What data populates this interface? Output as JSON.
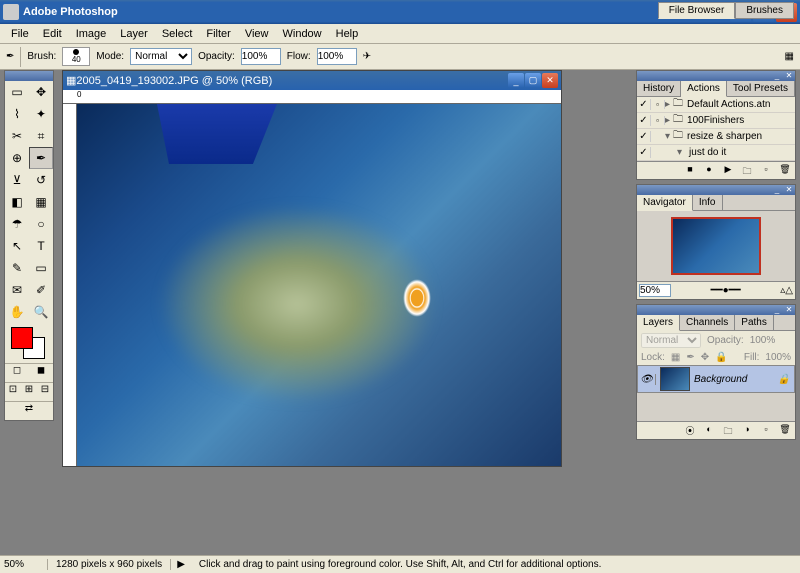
{
  "app": {
    "title": "Adobe Photoshop"
  },
  "menu": [
    "File",
    "Edit",
    "Image",
    "Layer",
    "Select",
    "Filter",
    "View",
    "Window",
    "Help"
  ],
  "options": {
    "brush_label": "Brush:",
    "brush_size": "40",
    "mode_label": "Mode:",
    "mode_value": "Normal",
    "opacity_label": "Opacity:",
    "opacity_value": "100%",
    "flow_label": "Flow:",
    "flow_value": "100%"
  },
  "palettewell": [
    "File Browser",
    "Brushes"
  ],
  "document": {
    "title": "2005_0419_193002.JPG @ 50% (RGB)",
    "ruler_mark": "0"
  },
  "actions_panel": {
    "tabs": [
      "History",
      "Actions",
      "Tool Presets"
    ],
    "items": [
      {
        "check": "✓",
        "dlg": "▫",
        "indent": 0,
        "tree": "▸",
        "folder": true,
        "label": "Default Actions.atn"
      },
      {
        "check": "✓",
        "dlg": "▫",
        "indent": 0,
        "tree": "▸",
        "folder": true,
        "label": "100Finishers"
      },
      {
        "check": "✓",
        "dlg": "",
        "indent": 0,
        "tree": "▾",
        "folder": true,
        "label": "resize & sharpen"
      },
      {
        "check": "✓",
        "dlg": "",
        "indent": 1,
        "tree": "▾",
        "folder": false,
        "label": "just do it"
      }
    ]
  },
  "navigator": {
    "tabs": [
      "Navigator",
      "Info"
    ],
    "zoom": "50%"
  },
  "layers": {
    "tabs": [
      "Layers",
      "Channels",
      "Paths"
    ],
    "blend": "Normal",
    "opacity_label": "Opacity:",
    "opacity": "100%",
    "lock_label": "Lock:",
    "fill_label": "Fill:",
    "fill": "100%",
    "items": [
      {
        "name": "Background",
        "locked": true
      }
    ]
  },
  "status": {
    "zoom": "50%",
    "dimensions": "1280 pixels x 960 pixels",
    "hint": "Click and drag to paint using foreground color. Use Shift, Alt, and Ctrl for additional options."
  },
  "colors": {
    "fg": "#ff0000",
    "bg": "#ffffff"
  }
}
